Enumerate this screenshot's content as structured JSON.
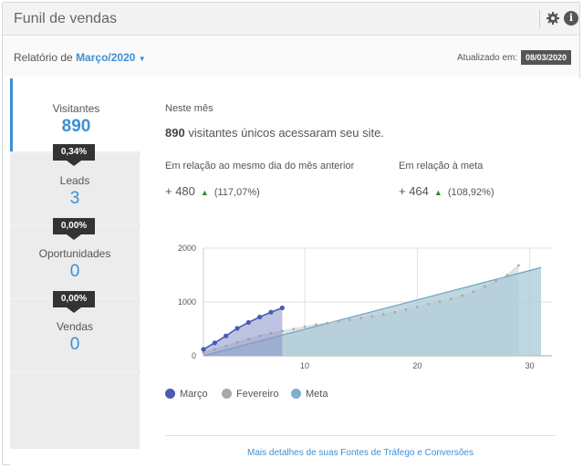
{
  "header": {
    "title": "Funil de vendas"
  },
  "subbar": {
    "report_prefix": "Relatório de",
    "report_month": "Março/2020",
    "updated_label": "Atualizado em:",
    "updated_date": "08/03/2020"
  },
  "funnel": {
    "stages": [
      {
        "label": "Visitantes",
        "value": "890"
      },
      {
        "label": "Leads",
        "value": "3"
      },
      {
        "label": "Oportunidades",
        "value": "0"
      },
      {
        "label": "Vendas",
        "value": "0"
      }
    ],
    "rates": [
      "0,34%",
      "0,00%",
      "0,00%"
    ]
  },
  "details": {
    "month_label": "Neste mês",
    "summary_number": "890",
    "summary_text": "visitantes únicos acessaram seu site.",
    "prev_label": "Em relação ao mesmo dia do mês anterior",
    "prev_value": "+ 480",
    "prev_pct": "(117,07%)",
    "goal_label": "Em relação à meta",
    "goal_value": "+ 464",
    "goal_pct": "(108,92%)",
    "footer_link": "Mais detalhes de suas Fontes de Tráfego e Conversões"
  },
  "colors": {
    "marco": "#4a5bb0",
    "fevereiro": "#a8a8a8",
    "meta": "#7bb0cc",
    "accent": "#3d8fd6"
  },
  "chart_data": {
    "type": "area",
    "xlim": [
      1,
      31
    ],
    "ylim": [
      0,
      2000
    ],
    "yticks": [
      "2000",
      "1000",
      "0"
    ],
    "xticks": [
      "10",
      "20",
      "30"
    ],
    "series": [
      {
        "name": "Março",
        "x": [
          1,
          2,
          3,
          4,
          5,
          6,
          7,
          8
        ],
        "values": [
          120,
          240,
          370,
          510,
          620,
          720,
          810,
          890
        ]
      },
      {
        "name": "Fevereiro",
        "x": [
          1,
          2,
          3,
          4,
          5,
          6,
          7,
          8,
          9,
          10,
          11,
          12,
          13,
          14,
          15,
          16,
          17,
          18,
          19,
          20,
          21,
          22,
          23,
          24,
          25,
          26,
          27,
          28,
          29
        ],
        "values": [
          60,
          120,
          180,
          250,
          310,
          370,
          420,
          460,
          500,
          540,
          580,
          610,
          640,
          670,
          700,
          730,
          770,
          810,
          860,
          910,
          960,
          1010,
          1060,
          1120,
          1190,
          1290,
          1390,
          1500,
          1680
        ]
      },
      {
        "name": "Meta",
        "x": [
          1,
          31
        ],
        "values": [
          0,
          1640
        ]
      }
    ],
    "legend": [
      "Março",
      "Fevereiro",
      "Meta"
    ],
    "legend_position": "bottom"
  }
}
